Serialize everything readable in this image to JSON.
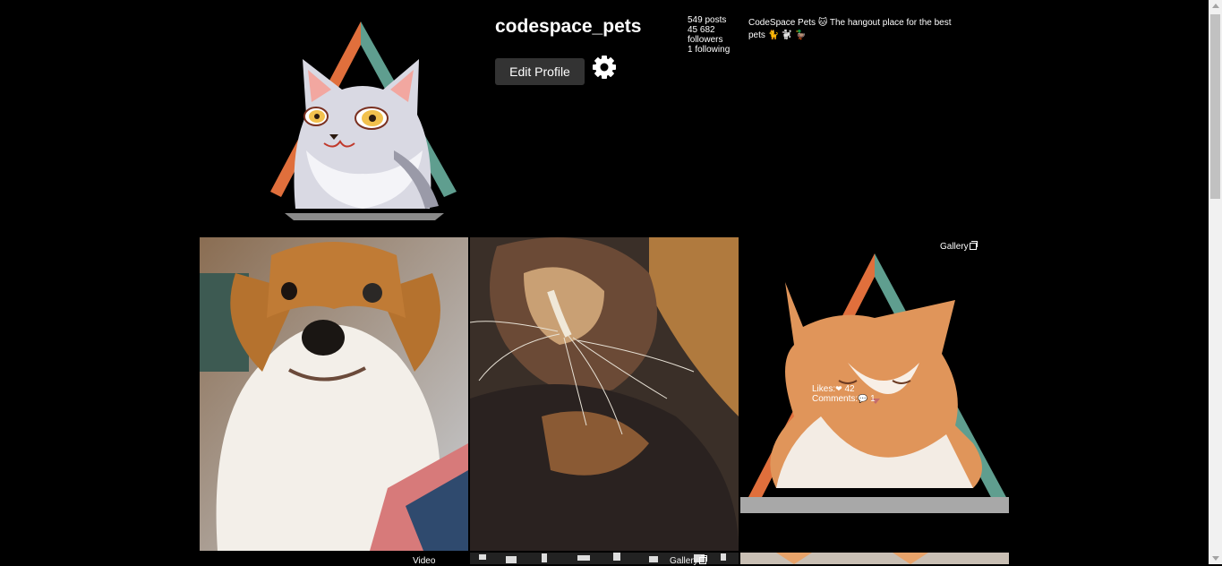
{
  "profile": {
    "username": "codespace_pets",
    "edit_label": "Edit Profile",
    "settings_icon": "gear-icon",
    "stats": {
      "posts": "549 posts",
      "followers_count": "45 682",
      "followers_label": "followers",
      "following": "1 following"
    },
    "bio_line1": "CodeSpace Pets 🐱 The hangout place for the best",
    "bio_line2": "pets 🐈 🐩 🦆"
  },
  "posts": [
    {
      "alt": "Puppy",
      "type": ""
    },
    {
      "alt": "Tortoiseshell cat",
      "type": ""
    },
    {
      "alt": "Orange cat",
      "type": "Gallery",
      "likes_label": "Likes:",
      "likes": "42",
      "comments_label": "Comments:",
      "comments": "1",
      "like_icon": "heart-icon",
      "comment_icon": "speech-bubble-icon"
    },
    {
      "alt": "",
      "type": "Video"
    },
    {
      "alt": "",
      "type": "Gallery"
    },
    {
      "alt": "",
      "type": ""
    }
  ],
  "colors": {
    "background": "#000000",
    "button": "#333333",
    "triangle_left": "#e06f3c",
    "triangle_right": "#5f9e8f"
  }
}
